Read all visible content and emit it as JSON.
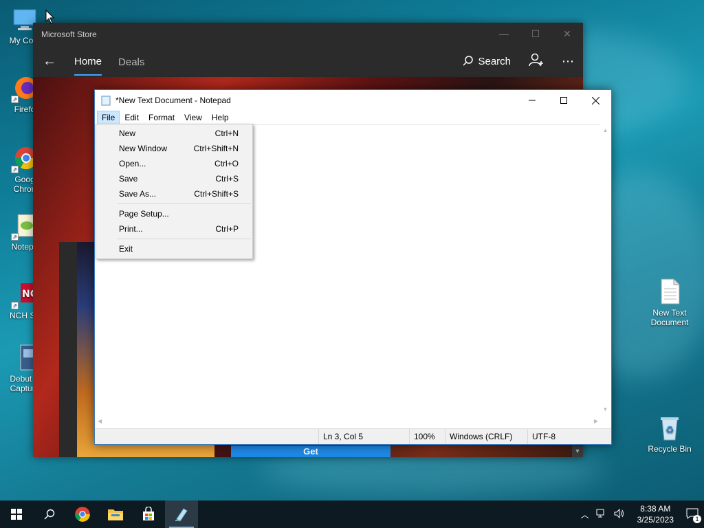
{
  "desktop": {
    "icons_left": [
      {
        "label": "My Com",
        "name": "my-computer"
      },
      {
        "label": "Firefo",
        "name": "firefox"
      },
      {
        "label": "Goog\nChron",
        "name": "google-chrome"
      },
      {
        "label": "Notepa",
        "name": "notepad"
      },
      {
        "label": "NCH Su",
        "name": "nch-suite"
      },
      {
        "label": "Debut V\nCapture",
        "name": "debut-video-capture"
      }
    ],
    "new_text_document": "New Text\nDocument",
    "recycle_bin": "Recycle Bin"
  },
  "store": {
    "title": "Microsoft Store",
    "tabs": [
      "Home",
      "Deals"
    ],
    "search_label": "Search",
    "get_button": "Get"
  },
  "notepad": {
    "title": "*New Text Document - Notepad",
    "menu": [
      "File",
      "Edit",
      "Format",
      "View",
      "Help"
    ],
    "status": {
      "position": "Ln 3, Col 5",
      "zoom": "100%",
      "line_endings": "Windows (CRLF)",
      "encoding": "UTF-8"
    }
  },
  "file_menu": {
    "items": [
      {
        "label": "New",
        "shortcut": "Ctrl+N"
      },
      {
        "label": "New Window",
        "shortcut": "Ctrl+Shift+N"
      },
      {
        "label": "Open...",
        "shortcut": "Ctrl+O"
      },
      {
        "label": "Save",
        "shortcut": "Ctrl+S"
      },
      {
        "label": "Save As...",
        "shortcut": "Ctrl+Shift+S"
      },
      {
        "label": "Page Setup...",
        "shortcut": ""
      },
      {
        "label": "Print...",
        "shortcut": "Ctrl+P"
      },
      {
        "label": "Exit",
        "shortcut": ""
      }
    ]
  },
  "taskbar": {
    "apps": [
      "start-icon",
      "search-icon",
      "chrome-icon",
      "file-explorer-icon",
      "store-icon",
      "notepad-icon"
    ],
    "time": "8:38 AM",
    "date": "3/25/2023",
    "notification_count": "1"
  },
  "colors": {
    "accent": "#0078d7",
    "store_get": "#1e88e5",
    "menu_highlight": "#cce8ff"
  }
}
